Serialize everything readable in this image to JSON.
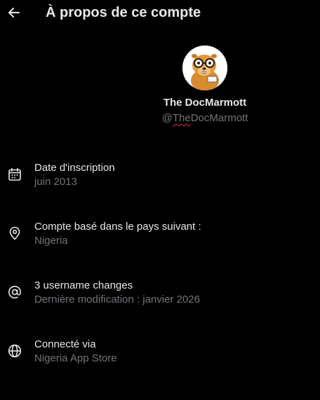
{
  "header": {
    "back_icon": "arrow-left-icon",
    "title": "À propos de ce compte"
  },
  "profile": {
    "display_name": "The DocMarmott",
    "handle_prefix": "@",
    "handle_underlined": "The",
    "handle_rest": "DocMarmott"
  },
  "details": [
    {
      "icon": "calendar-icon",
      "label": "Date d'inscription",
      "value": "juin 2013"
    },
    {
      "icon": "location-pin-icon",
      "label": "Compte basé dans le pays suivant :",
      "value": "Nigeria"
    },
    {
      "icon": "at-sign-icon",
      "label": "3 username changes",
      "value": "Dernière modification : janvier 2026"
    },
    {
      "icon": "globe-icon",
      "label": "Connecté via",
      "value": "Nigeria App Store"
    }
  ],
  "colors": {
    "background": "#000000",
    "primary_text": "#e7e9ea",
    "secondary_text": "#71767b",
    "spellcheck_underline": "#e0245e"
  }
}
